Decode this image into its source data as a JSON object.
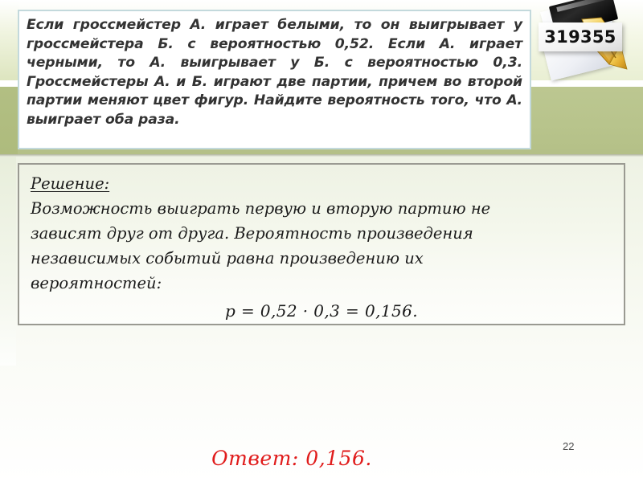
{
  "slide": {
    "page_number": "22",
    "accent_green": "#b8c48c",
    "answer_color": "#e01b1b",
    "problem_border_color": "#c3d9dc",
    "solution_border_color": "#9a9a92"
  },
  "decoration": {
    "task_number": "319355",
    "book_icon": "notebook-icon",
    "pen_icon": "fountain-pen-nib-icon"
  },
  "problem": {
    "lines": [
      "Если гроссмейстер А. играет белыми, то он",
      "выигрывает у гроссмейстера Б. с вероятностью 0,52.",
      "Если А. играет черными, то А. выигрывает у Б. с",
      "вероятностью 0,3.",
      "Гроссмейстеры А. и Б. играют две партии, причем во",
      "второй партии меняют цвет фигур. Найдите",
      "вероятность того, что А. выиграет оба раза."
    ],
    "full_text": "Если гроссмейстер А. играет белыми, то он выигрывает у гроссмейстера Б. с вероятностью 0,52. Если А. играет черными, то А. выигрывает у Б. с вероятностью 0,3. Гроссмейстеры А. и Б. играют две партии, причем во второй партии меняют цвет фигур. Найдите вероятность того, что А. выиграет оба раза."
  },
  "solution": {
    "heading": "Решение:",
    "line1": "Возможность выиграть первую и вторую партию не",
    "line2": "зависят друг от друга. Вероятность произведения",
    "line3": "независимых событий равна произведению их",
    "line4": "вероятностей:",
    "formula": "p = 0,52 · 0,3 = 0,156."
  },
  "answer": {
    "text": "Ответ: 0,156."
  }
}
